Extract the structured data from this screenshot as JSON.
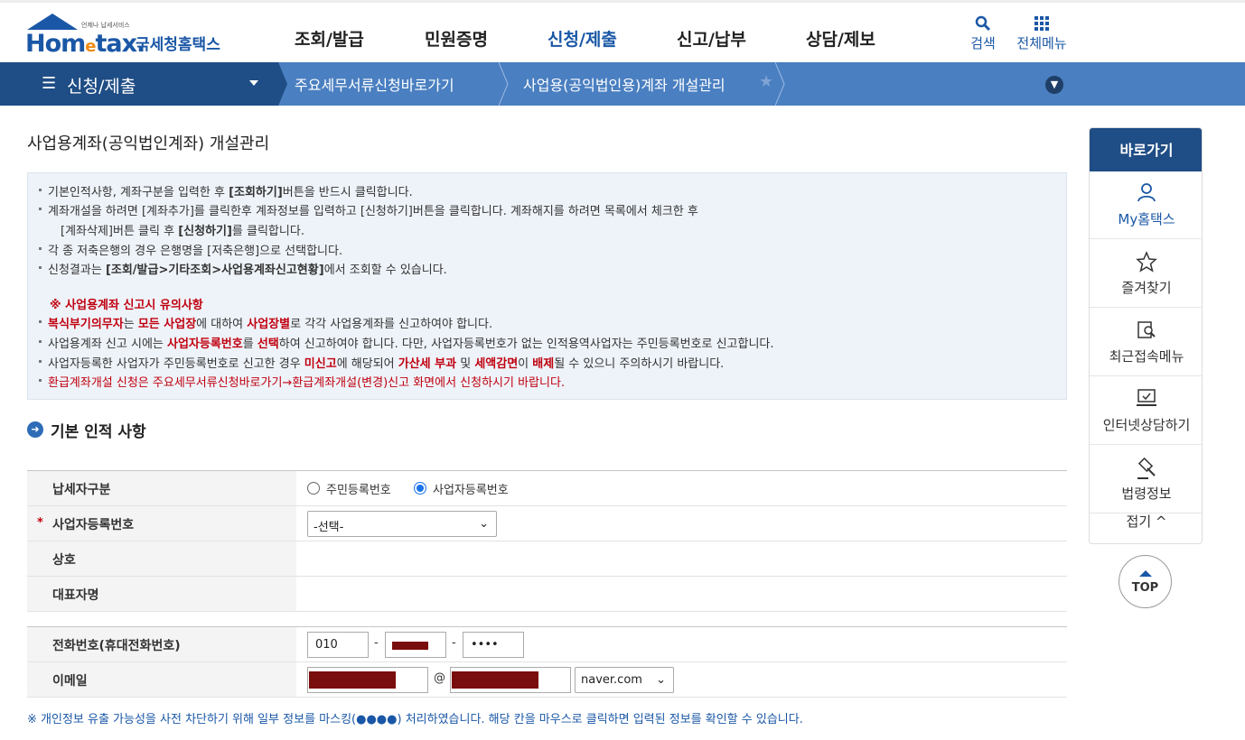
{
  "header": {
    "logo_sub": "언제나 납세서비스",
    "logo_main_1": "Hom",
    "logo_main_e": "e",
    "logo_main_2": "tax.",
    "logo_ko": "국세청홈택스",
    "nav": [
      "조회/발급",
      "민원증명",
      "신청/제출",
      "신고/납부",
      "상담/제보"
    ],
    "active_nav": "신청/제출",
    "search_label": "검색",
    "allmenu_label": "전체메뉴"
  },
  "subnav": {
    "menu_title": "신청/제출",
    "crumb1": "주요세무서류신청바로가기",
    "crumb2": "사업용(공익법인용)계좌 개설관리"
  },
  "page_title": "사업용계좌(공익법인계좌) 개설관리",
  "notice": {
    "l1_a": "기본인적사항, 계좌구분을 입력한 후 ",
    "l1_b": "[조회하기]",
    "l1_c": "버튼을 반드시 클릭합니다.",
    "l2": "계좌개설을 하려면 [계좌추가]를 클릭한후 계좌정보를 입력하고 [신청하기]버튼을 클릭합니다. 계좌해지를 하려면 목록에서 체크한 후",
    "l3_a": "[계좌삭제]버튼 클릭 후 ",
    "l3_b": "[신청하기]",
    "l3_c": "를 클릭합니다.",
    "l4": "각 종 저축은행의 경우 은행명을 [저축은행]으로 선택합니다.",
    "l5_a": "신청결과는 ",
    "l5_b": "[조회/발급>기타조회>사업용계좌신고현황]",
    "l5_c": "에서 조회할 수 있습니다.",
    "warn_title": "※ 사업용계좌 신고시 유의사항",
    "w1_a": "복식부기의무자",
    "w1_b": "는 ",
    "w1_c": "모든 사업장",
    "w1_d": "에 대하여 ",
    "w1_e": "사업장별",
    "w1_f": "로 각각 사업용계좌를 신고하여야 합니다.",
    "w2_a": "사업용계좌 신고 시에는 ",
    "w2_b": "사업자등록번호",
    "w2_c": "를 ",
    "w2_d": "선택",
    "w2_e": "하여 신고하여야 합니다. 다만, 사업자등록번호가 없는 인적용역사업자는 주민등록번호로 신고합니다.",
    "w3_a": "사업자등록한 사업자가 주민등록번호로 신고한 경우 ",
    "w3_b": "미신고",
    "w3_c": "에 해당되어 ",
    "w3_d": "가산세 부과",
    "w3_e": " 및 ",
    "w3_f": "세액감면",
    "w3_g": "이 ",
    "w3_h": "배제",
    "w3_i": "될 수 있으니 주의하시기 바랍니다.",
    "w4": "환급계좌개설 신청은 주요세무서류신청바로가기→환급계좌개설(변경)신고 화면에서 신청하시기 바랍니다."
  },
  "section_title": "기본 인적 사항",
  "form": {
    "taxpayer_type_label": "납세자구분",
    "radio_resident": "주민등록번호",
    "radio_business": "사업자등록번호",
    "selected_type": "사업자등록번호",
    "bizno_label": "사업자등록번호",
    "bizno_select": "-선택-",
    "company_label": "상호",
    "company_value": "",
    "rep_label": "대표자명",
    "rep_value": "",
    "phone_label": "전화번호(휴대전화번호)",
    "phone1": "010",
    "phone_sep": "-",
    "phone3": "••••",
    "email_label": "이메일",
    "email_at": "@",
    "email_domain": "naver.com"
  },
  "privacy_note": "※ 개인정보 유출 가능성을 사전 차단하기 위해 일부 정보를 마스킹(●●●●) 처리하였습니다. 해당 칸을 마우스로 클릭하면 입력된 정보를 확인할 수 있습니다.",
  "quick": {
    "title": "바로가기",
    "items": [
      "My홈택스",
      "즐겨찾기",
      "최근접속메뉴",
      "인터넷상담하기",
      "법령정보"
    ],
    "fold": "접기 ^",
    "top": "TOP"
  },
  "colors": {
    "brand": "#1a57a6",
    "subnav_dark": "#1f4d85",
    "subnav": "#4a7fc1",
    "warn": "#c0000f"
  }
}
